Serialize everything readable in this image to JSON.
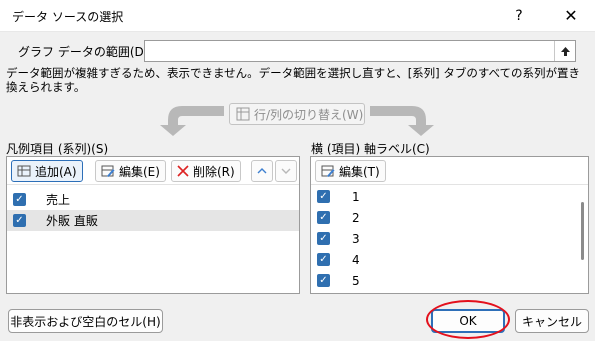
{
  "window": {
    "title": "データ ソースの選択",
    "help_icon": "?",
    "close_icon": "✕"
  },
  "range": {
    "label": "グラフ データの範囲(D):",
    "value": ""
  },
  "warning": "データ範囲が複雑すぎるため、表示できません。データ範囲を選択し直すと、[系列] タブのすべての系列が置き換えられます。",
  "switch_button": {
    "label": "行/列の切り替え(W)"
  },
  "legend": {
    "label": "凡例項目 (系列)(S)",
    "add_label": "追加(A)",
    "edit_label": "編集(E)",
    "delete_label": "削除(R)",
    "series": [
      {
        "name": "売上",
        "checked": true,
        "selected": false
      },
      {
        "name": "外販 直販",
        "checked": true,
        "selected": true
      }
    ]
  },
  "axis": {
    "label": "横 (項目) 軸ラベル(C)",
    "edit_label": "編集(T)",
    "items": [
      {
        "label": "1",
        "checked": true
      },
      {
        "label": "2",
        "checked": true
      },
      {
        "label": "3",
        "checked": true
      },
      {
        "label": "4",
        "checked": true
      },
      {
        "label": "5",
        "checked": true
      }
    ]
  },
  "buttons": {
    "hidden_cells": "非表示および空白のセル(H)",
    "ok": "OK",
    "cancel": "キャンセル"
  },
  "colors": {
    "accent": "#2f6fb0",
    "highlight": "#e3101c"
  }
}
